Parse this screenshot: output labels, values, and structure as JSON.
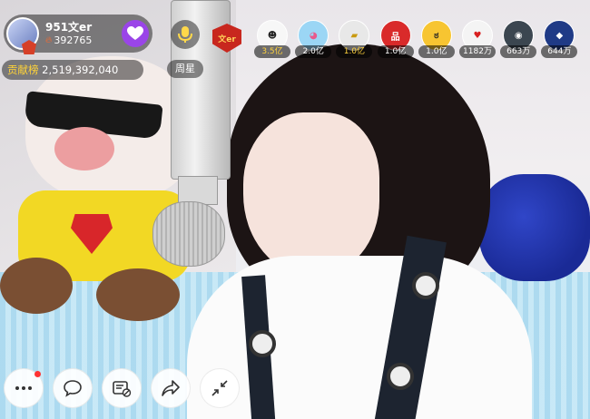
{
  "host": {
    "name": "951文er",
    "heat": "392765",
    "avatar_icon": "host-avatar-icon",
    "follow_icon": "heart-follow-icon",
    "accent_color": "#9a45e8"
  },
  "contribution": {
    "label": "贡献榜",
    "value": "2,519,392,040"
  },
  "weekstar": {
    "label": "周星"
  },
  "fan_badge": {
    "text": "文er"
  },
  "viewers": [
    {
      "value": "3.5亿",
      "gold": true,
      "bg": "#f7f7f7",
      "fg": "#222",
      "glyph": "☻"
    },
    {
      "value": "2.0亿",
      "gold": false,
      "bg": "#9bd6f5",
      "fg": "#e85a8c",
      "glyph": "◕"
    },
    {
      "value": "1.0亿",
      "gold": true,
      "bg": "#e8e8e8",
      "fg": "#c99a10",
      "glyph": "▰"
    },
    {
      "value": "1.0亿",
      "gold": false,
      "bg": "#d92a2a",
      "fg": "#fff",
      "glyph": "品"
    },
    {
      "value": "1.0亿",
      "gold": false,
      "bg": "#f7c531",
      "fg": "#222",
      "glyph": "ಠ"
    },
    {
      "value": "1182万",
      "gold": false,
      "bg": "#f4f4f4",
      "fg": "#d82020",
      "glyph": "♥"
    },
    {
      "value": "663万",
      "gold": false,
      "bg": "#3b4650",
      "fg": "#fff",
      "glyph": "◉"
    },
    {
      "value": "644万",
      "gold": false,
      "bg": "#1f3a86",
      "fg": "#fff",
      "glyph": "◆"
    }
  ],
  "toolbar": {
    "more_icon": "more-dots-icon",
    "chat_icon": "chat-bubble-icon",
    "danmaku_icon": "danmaku-toggle-icon",
    "share_icon": "share-arrow-icon",
    "minimize_icon": "shrink-icon"
  }
}
